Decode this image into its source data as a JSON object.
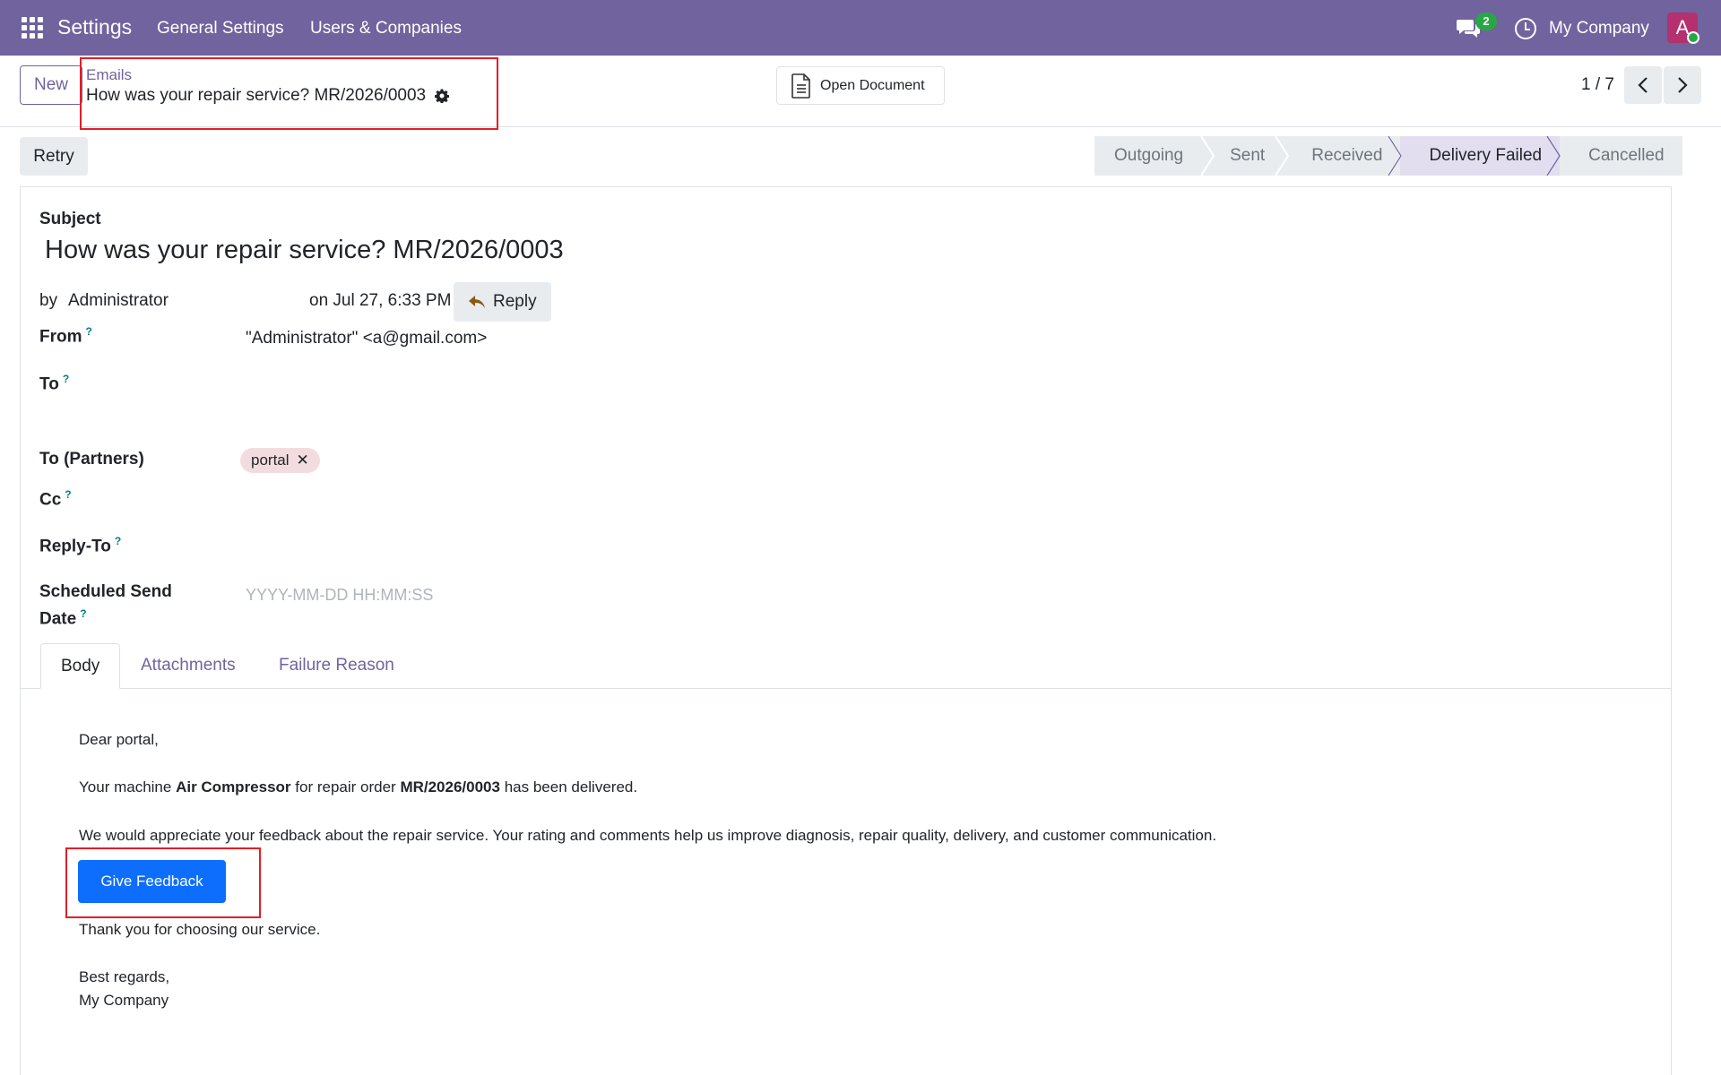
{
  "navbar": {
    "app_name": "Settings",
    "menu": [
      "General Settings",
      "Users & Companies"
    ],
    "chat_count": "2",
    "company": "My Company",
    "avatar_letter": "A",
    "colors": {
      "bar": "#71639e",
      "avatar": "#b5306e",
      "badge": "#28a745"
    }
  },
  "control_panel": {
    "new_label": "New",
    "breadcrumb_parent": "Emails",
    "breadcrumb_current": "How was your repair service? MR/2026/0003",
    "open_document_label": "Open Document",
    "pager": "1 / 7"
  },
  "status": {
    "retry_label": "Retry",
    "stages": [
      "Outgoing",
      "Sent",
      "Received",
      "Delivery Failed",
      "Cancelled"
    ],
    "active_stage": "Delivery Failed"
  },
  "form": {
    "subject_label": "Subject",
    "subject": "How was your repair service? MR/2026/0003",
    "by_label": "by",
    "author": "Administrator",
    "date": "on Jul 27, 6:33 PM",
    "reply_label": "Reply",
    "from_label": "From",
    "from_value": "\"Administrator\" <a@gmail.com>",
    "to_label": "To",
    "to_partners_label": "To (Partners)",
    "partner_tag": "portal",
    "cc_label": "Cc",
    "reply_to_label": "Reply-To",
    "scheduled_label_1": "Scheduled Send",
    "scheduled_label_2": "Date",
    "scheduled_placeholder": "YYYY-MM-DD HH:MM:SS",
    "help_mark": "?"
  },
  "tabs": [
    "Body",
    "Attachments",
    "Failure Reason"
  ],
  "body": {
    "greeting": "Dear portal,",
    "line1_pre": "Your machine ",
    "machine": "Air Compressor",
    "line1_mid": " for repair order ",
    "order": "MR/2026/0003",
    "line1_post": " has been delivered.",
    "line2": "We would appreciate your feedback about the repair service. Your rating and comments help us improve diagnosis, repair quality, delivery, and customer communication.",
    "feedback_button": "Give Feedback",
    "thanks": "Thank you for choosing our service.",
    "regards": "Best regards,",
    "signature": "My Company"
  }
}
